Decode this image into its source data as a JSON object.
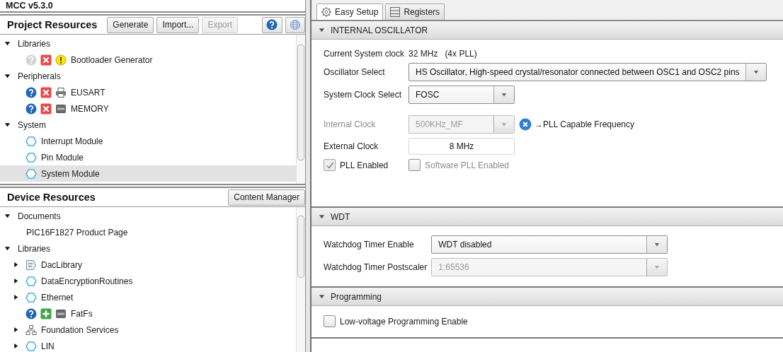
{
  "window": {
    "title": "MCC v5.3.0"
  },
  "project_resources": {
    "title": "Project Resources",
    "buttons": [
      {
        "kind": "text",
        "label": "Generate",
        "disabled": false
      },
      {
        "kind": "text",
        "label": "Import...",
        "disabled": false
      },
      {
        "kind": "text",
        "label": "Export",
        "disabled": true
      },
      {
        "kind": "help"
      },
      {
        "kind": "globe"
      }
    ],
    "tree": [
      {
        "label": "Libraries",
        "expanded": true,
        "selected": false,
        "children": [
          {
            "label": "Bootloader Generator",
            "icons": [
              {
                "kind": "help-disabled"
              },
              {
                "kind": "remove"
              },
              {
                "kind": "warning"
              }
            ],
            "selected": false
          }
        ]
      },
      {
        "label": "Peripherals",
        "expanded": true,
        "selected": false,
        "children": [
          {
            "label": "EUSART",
            "icons": [
              {
                "kind": "help"
              },
              {
                "kind": "remove"
              },
              {
                "kind": "printer"
              }
            ],
            "selected": false
          },
          {
            "label": "MEMORY",
            "icons": [
              {
                "kind": "help"
              },
              {
                "kind": "remove"
              },
              {
                "kind": "chip"
              }
            ],
            "selected": false
          }
        ]
      },
      {
        "label": "System",
        "expanded": true,
        "selected": false,
        "children": [
          {
            "label": "Interrupt Module",
            "icons": [
              {
                "kind": "hexagon"
              }
            ],
            "selected": false
          },
          {
            "label": "Pin Module",
            "icons": [
              {
                "kind": "hexagon"
              }
            ],
            "selected": false
          },
          {
            "label": "System Module",
            "icons": [
              {
                "kind": "hexagon"
              }
            ],
            "selected": true
          }
        ]
      }
    ]
  },
  "device_resources": {
    "title": "Device Resources",
    "buttons": [
      {
        "kind": "text",
        "label": "Content Manager",
        "disabled": false
      }
    ],
    "tree": [
      {
        "label": "Documents",
        "expanded": true,
        "selected": false,
        "children": [
          {
            "label": "PIC16F1827 Product Page",
            "selected": false
          }
        ]
      },
      {
        "label": "Libraries",
        "expanded": true,
        "selected": false,
        "children": [
          {
            "label": "DacLibrary",
            "expanded": false,
            "icons": [
              {
                "kind": "tag"
              }
            ],
            "selected": false
          },
          {
            "label": "DataEncryptionRoutines",
            "expanded": false,
            "icons": [
              {
                "kind": "hexagon"
              }
            ],
            "selected": false
          },
          {
            "label": "Ethernet",
            "expanded": false,
            "icons": [
              {
                "kind": "hexagon"
              }
            ],
            "selected": false
          },
          {
            "label": "FatFs",
            "icons": [
              {
                "kind": "help"
              },
              {
                "kind": "add"
              },
              {
                "kind": "chip"
              }
            ],
            "selected": false
          },
          {
            "label": "Foundation Services",
            "expanded": false,
            "icons": [
              {
                "kind": "network"
              }
            ],
            "selected": false
          },
          {
            "label": "LIN",
            "expanded": false,
            "icons": [
              {
                "kind": "hexagon"
              }
            ],
            "selected": false
          }
        ]
      }
    ]
  },
  "tabs": [
    {
      "label": "Easy Setup",
      "selected": true
    },
    {
      "label": "Registers",
      "selected": false
    }
  ],
  "sections": [
    {
      "title": "INTERNAL OSCILLATOR",
      "expanded": true,
      "rows": [
        {
          "kind": "reading",
          "label": "Current System clock",
          "value": "32 MHz",
          "note": "(4x PLL)"
        },
        {
          "kind": "select",
          "label": "Oscillator Select",
          "value": "HS Oscillator, High-speed crystal/resonator connected between OSC1 and OSC2 pins",
          "disabled": false
        },
        {
          "kind": "select",
          "label": "System Clock Select",
          "value": "FOSC",
          "disabled": false
        },
        {
          "kind": "select",
          "label": "Internal Clock",
          "value": "500KHz_MF",
          "disabled": true,
          "hint": "→PLL Capable Frequency"
        },
        {
          "kind": "text",
          "label": "External Clock",
          "value": "8 MHz"
        },
        {
          "kind": "checks",
          "items": [
            {
              "label": "PLL Enabled",
              "checked": true,
              "disabled": false
            },
            {
              "label": "Software PLL Enabled",
              "checked": false,
              "disabled": true
            }
          ]
        }
      ]
    },
    {
      "title": "WDT",
      "expanded": true,
      "rows": [
        {
          "kind": "select",
          "label": "Watchdog Timer Enable",
          "value": "WDT disabled",
          "disabled": false
        },
        {
          "kind": "select",
          "label": "Watchdog Timer Postscaler",
          "value": "1:65536",
          "disabled": true
        }
      ]
    },
    {
      "title": "Programming",
      "expanded": true,
      "rows": [
        {
          "kind": "checks",
          "items": [
            {
              "label": "Low-voltage Programming Enable",
              "checked": false,
              "disabled": false
            }
          ]
        }
      ]
    }
  ]
}
